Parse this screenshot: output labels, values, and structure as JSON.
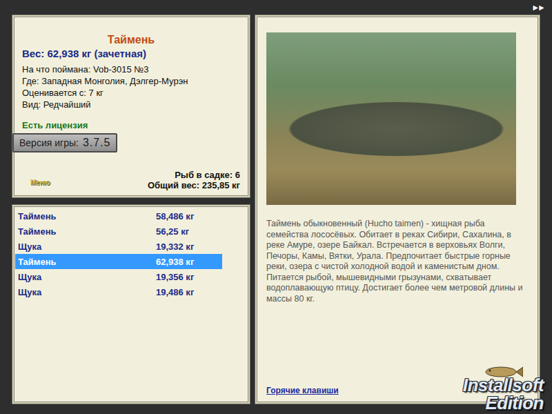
{
  "nav": {
    "forward": "►►"
  },
  "fish": {
    "title": "Таймень",
    "weight": "Вес: 62,938 кг (зачетная)",
    "details": [
      "На что поймана: Vob-3015 №3",
      "Где: Западная Монголия, Дэлгер-Мурэн",
      "Оценивается с: 7 кг",
      "Вид: Редчайший"
    ],
    "license": "Есть лицензия"
  },
  "version": {
    "label": "Версия игры:",
    "value": "3.7.5"
  },
  "menu": "Меню",
  "keepnet": {
    "count": "Рыб в садке: 6",
    "total": "Общий вес: 235,85 кг"
  },
  "catch_list": [
    {
      "name": "Таймень",
      "weight": "58,486 кг",
      "selected": false
    },
    {
      "name": "Таймень",
      "weight": "56,25 кг",
      "selected": false
    },
    {
      "name": "Щука",
      "weight": "19,332 кг",
      "selected": false
    },
    {
      "name": "Таймень",
      "weight": "62,938 кг",
      "selected": true
    },
    {
      "name": "Щука",
      "weight": "19,356 кг",
      "selected": false
    },
    {
      "name": "Щука",
      "weight": "19,486 кг",
      "selected": false
    }
  ],
  "description": "Таймень обыкновенный (Hucho taimen) - хищная рыба семейства лососёвых. Обитает в реках Сибири, Сахалина, в реке Амуре, озере Байкал. Встречается в верховьях Волги, Печоры, Камы, Вятки, Урала. Предпочитает быстрые горные реки, озера с чистой холодной водой и каменистым дном. Питается рыбой, мышевидными грызунами, схватывает водоплавающую птицу. Достигает более чем метровой длины и массы 80 кг.",
  "hotkeys_link": "Горячие клавиши",
  "logo": {
    "line1": "Installsoft",
    "line2": "Edition"
  }
}
